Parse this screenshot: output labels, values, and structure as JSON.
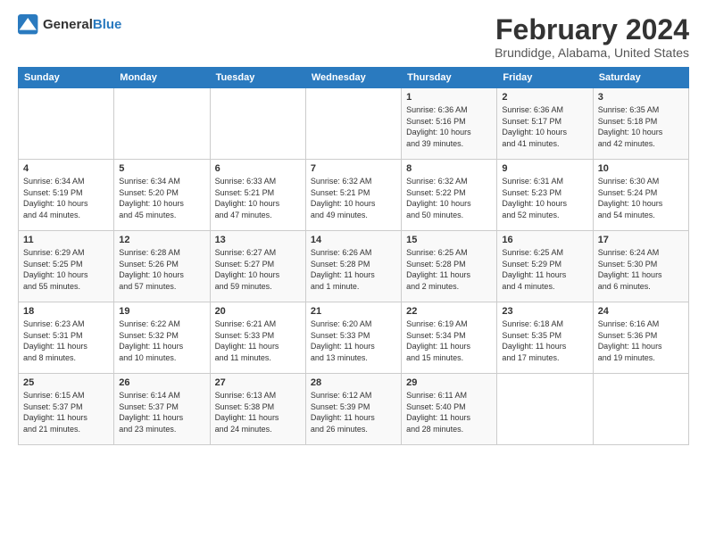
{
  "logo": {
    "text_general": "General",
    "text_blue": "Blue"
  },
  "title": "February 2024",
  "subtitle": "Brundidge, Alabama, United States",
  "days_of_week": [
    "Sunday",
    "Monday",
    "Tuesday",
    "Wednesday",
    "Thursday",
    "Friday",
    "Saturday"
  ],
  "weeks": [
    [
      {
        "day": "",
        "info": ""
      },
      {
        "day": "",
        "info": ""
      },
      {
        "day": "",
        "info": ""
      },
      {
        "day": "",
        "info": ""
      },
      {
        "day": "1",
        "info": "Sunrise: 6:36 AM\nSunset: 5:16 PM\nDaylight: 10 hours\nand 39 minutes."
      },
      {
        "day": "2",
        "info": "Sunrise: 6:36 AM\nSunset: 5:17 PM\nDaylight: 10 hours\nand 41 minutes."
      },
      {
        "day": "3",
        "info": "Sunrise: 6:35 AM\nSunset: 5:18 PM\nDaylight: 10 hours\nand 42 minutes."
      }
    ],
    [
      {
        "day": "4",
        "info": "Sunrise: 6:34 AM\nSunset: 5:19 PM\nDaylight: 10 hours\nand 44 minutes."
      },
      {
        "day": "5",
        "info": "Sunrise: 6:34 AM\nSunset: 5:20 PM\nDaylight: 10 hours\nand 45 minutes."
      },
      {
        "day": "6",
        "info": "Sunrise: 6:33 AM\nSunset: 5:21 PM\nDaylight: 10 hours\nand 47 minutes."
      },
      {
        "day": "7",
        "info": "Sunrise: 6:32 AM\nSunset: 5:21 PM\nDaylight: 10 hours\nand 49 minutes."
      },
      {
        "day": "8",
        "info": "Sunrise: 6:32 AM\nSunset: 5:22 PM\nDaylight: 10 hours\nand 50 minutes."
      },
      {
        "day": "9",
        "info": "Sunrise: 6:31 AM\nSunset: 5:23 PM\nDaylight: 10 hours\nand 52 minutes."
      },
      {
        "day": "10",
        "info": "Sunrise: 6:30 AM\nSunset: 5:24 PM\nDaylight: 10 hours\nand 54 minutes."
      }
    ],
    [
      {
        "day": "11",
        "info": "Sunrise: 6:29 AM\nSunset: 5:25 PM\nDaylight: 10 hours\nand 55 minutes."
      },
      {
        "day": "12",
        "info": "Sunrise: 6:28 AM\nSunset: 5:26 PM\nDaylight: 10 hours\nand 57 minutes."
      },
      {
        "day": "13",
        "info": "Sunrise: 6:27 AM\nSunset: 5:27 PM\nDaylight: 10 hours\nand 59 minutes."
      },
      {
        "day": "14",
        "info": "Sunrise: 6:26 AM\nSunset: 5:28 PM\nDaylight: 11 hours\nand 1 minute."
      },
      {
        "day": "15",
        "info": "Sunrise: 6:25 AM\nSunset: 5:28 PM\nDaylight: 11 hours\nand 2 minutes."
      },
      {
        "day": "16",
        "info": "Sunrise: 6:25 AM\nSunset: 5:29 PM\nDaylight: 11 hours\nand 4 minutes."
      },
      {
        "day": "17",
        "info": "Sunrise: 6:24 AM\nSunset: 5:30 PM\nDaylight: 11 hours\nand 6 minutes."
      }
    ],
    [
      {
        "day": "18",
        "info": "Sunrise: 6:23 AM\nSunset: 5:31 PM\nDaylight: 11 hours\nand 8 minutes."
      },
      {
        "day": "19",
        "info": "Sunrise: 6:22 AM\nSunset: 5:32 PM\nDaylight: 11 hours\nand 10 minutes."
      },
      {
        "day": "20",
        "info": "Sunrise: 6:21 AM\nSunset: 5:33 PM\nDaylight: 11 hours\nand 11 minutes."
      },
      {
        "day": "21",
        "info": "Sunrise: 6:20 AM\nSunset: 5:33 PM\nDaylight: 11 hours\nand 13 minutes."
      },
      {
        "day": "22",
        "info": "Sunrise: 6:19 AM\nSunset: 5:34 PM\nDaylight: 11 hours\nand 15 minutes."
      },
      {
        "day": "23",
        "info": "Sunrise: 6:18 AM\nSunset: 5:35 PM\nDaylight: 11 hours\nand 17 minutes."
      },
      {
        "day": "24",
        "info": "Sunrise: 6:16 AM\nSunset: 5:36 PM\nDaylight: 11 hours\nand 19 minutes."
      }
    ],
    [
      {
        "day": "25",
        "info": "Sunrise: 6:15 AM\nSunset: 5:37 PM\nDaylight: 11 hours\nand 21 minutes."
      },
      {
        "day": "26",
        "info": "Sunrise: 6:14 AM\nSunset: 5:37 PM\nDaylight: 11 hours\nand 23 minutes."
      },
      {
        "day": "27",
        "info": "Sunrise: 6:13 AM\nSunset: 5:38 PM\nDaylight: 11 hours\nand 24 minutes."
      },
      {
        "day": "28",
        "info": "Sunrise: 6:12 AM\nSunset: 5:39 PM\nDaylight: 11 hours\nand 26 minutes."
      },
      {
        "day": "29",
        "info": "Sunrise: 6:11 AM\nSunset: 5:40 PM\nDaylight: 11 hours\nand 28 minutes."
      },
      {
        "day": "",
        "info": ""
      },
      {
        "day": "",
        "info": ""
      }
    ]
  ]
}
